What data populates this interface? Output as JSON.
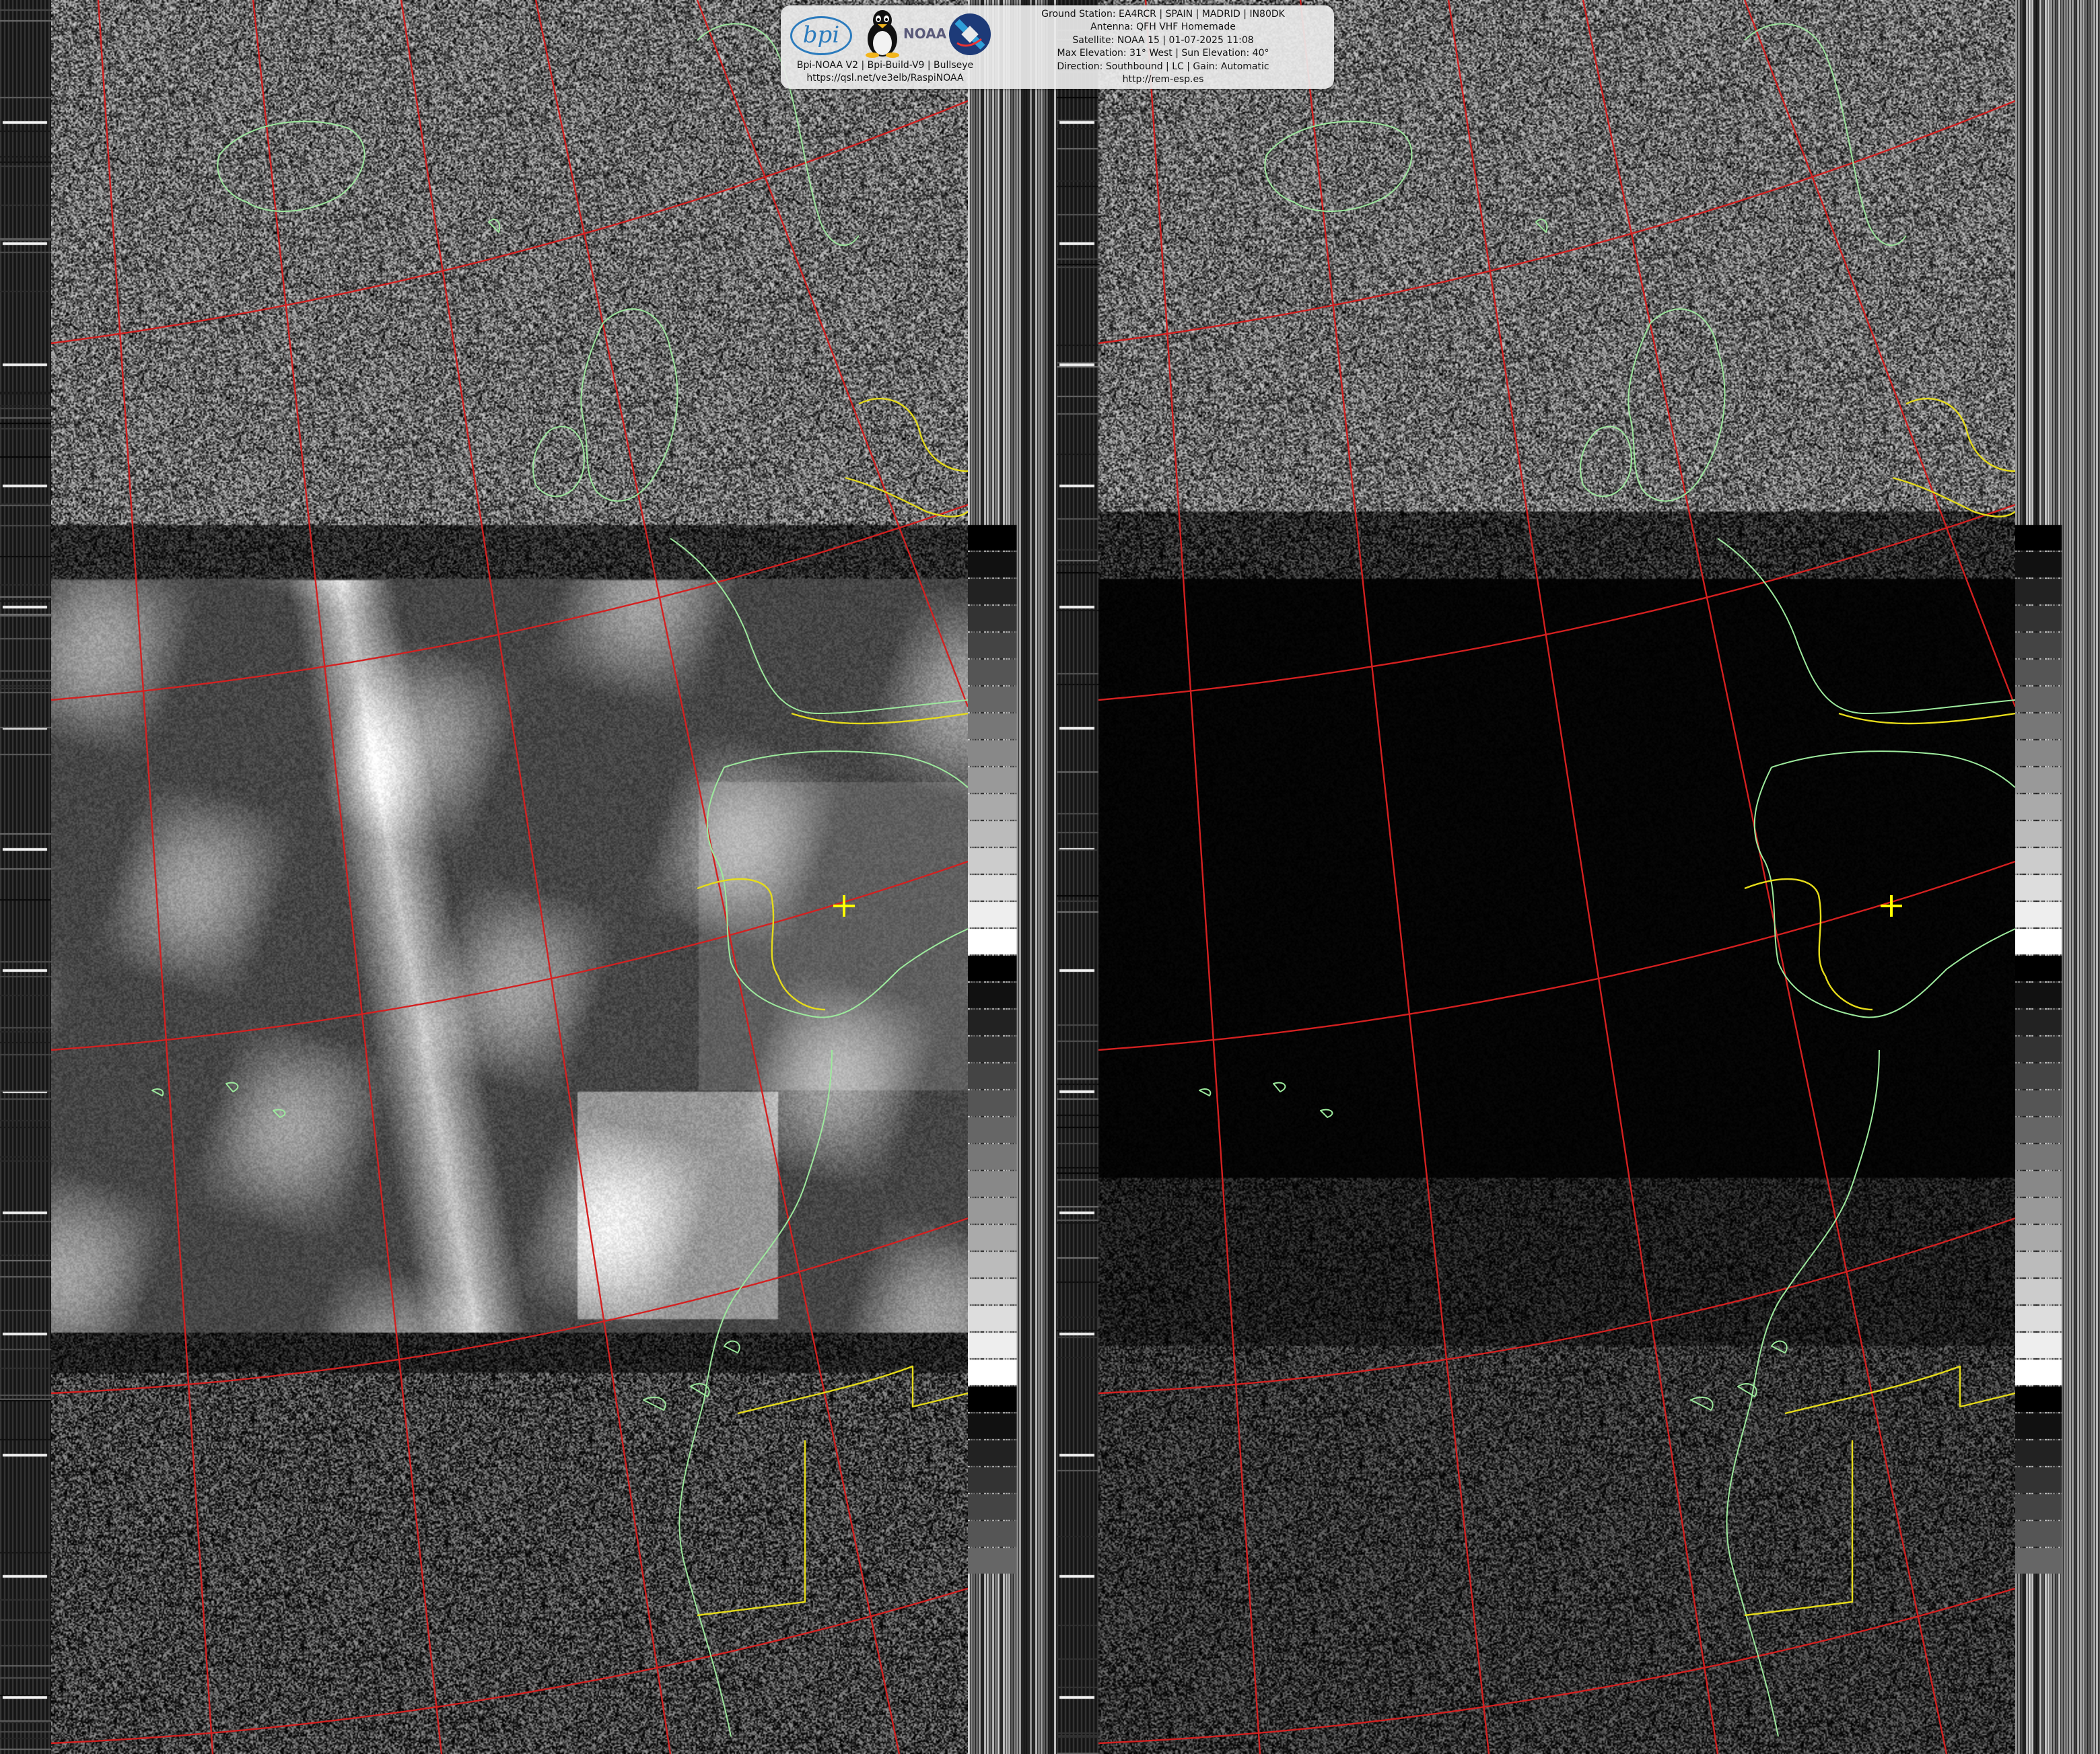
{
  "header": {
    "logos": [
      "bpi",
      "linux-tux-icon",
      "NOAA",
      "satellite-icon"
    ],
    "bpi_text": "bpi",
    "noaa_text": "NOAA",
    "left_lines": [
      "Bpi-NOAA V2 | Bpi-Build-V9 | Bullseye",
      "https://qsl.net/ve3elb/RaspiNOAA"
    ],
    "right_lines": [
      "Ground Station: EA4RCR | SPAIN | MADRID | IN80DK",
      "Antenna: QFH VHF Homemade",
      "Satellite: NOAA 15 | 01-07-2025 11:08",
      "Max Elevation: 31° West | Sun Elevation: 40°",
      "Direction: Southbound | LC | Gain: Automatic",
      "http://rem-esp.es"
    ]
  },
  "panels": [
    {
      "name": "channel-a-visible",
      "type": "visible"
    },
    {
      "name": "channel-b-infrared",
      "type": "infrared"
    }
  ],
  "colors": {
    "coastline": "#9dea9d",
    "borders": "#e6dc1a",
    "graticule": "#d42020",
    "station_marker": "#ffff00"
  },
  "marker": {
    "label": "ground-station-marker"
  }
}
